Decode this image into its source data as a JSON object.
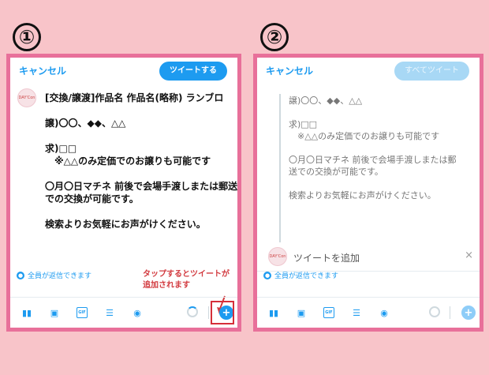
{
  "steps": {
    "one": "①",
    "two": "②"
  },
  "avatar_text": "[DAY'Con]",
  "panel1": {
    "cancel": "キャンセル",
    "tweet_button": "ツイートする",
    "tweet_text": "[交換/譲渡]作品名 作品名(略称) ランブロ\n\n譲)〇〇、◆◆、△△\n\n求)□□\n　※△△のみ定価でのお譲りも可能です\n\n〇月〇日マチネ 前後で会場手渡しまたは郵送での交換が可能です。\n\n検索よりお気軽にお声がけください。",
    "reply_setting": "全員が返信できます",
    "annotation": "タップするとツイートが\n追加されます"
  },
  "panel2": {
    "cancel": "キャンセル",
    "tweet_all_button": "すべてツイート",
    "tweet_text": "譲)〇〇、◆◆、△△\n\n求)□□\n　※△△のみ定価でのお譲りも可能です\n\n〇月〇日マチネ 前後で会場手渡しまたは郵送での交換が可能です。\n\n検索よりお気軽にお声がけください。",
    "add_tweet": "ツイートを追加",
    "close": "×",
    "reply_setting": "全員が返信できます"
  },
  "toolbar": {
    "gif_label": "GIF",
    "plus": "+"
  },
  "colors": {
    "accent": "#1d9bf0",
    "panel_border": "#e8709a",
    "background": "#f8c4c9",
    "annotation": "#d23a3f"
  }
}
